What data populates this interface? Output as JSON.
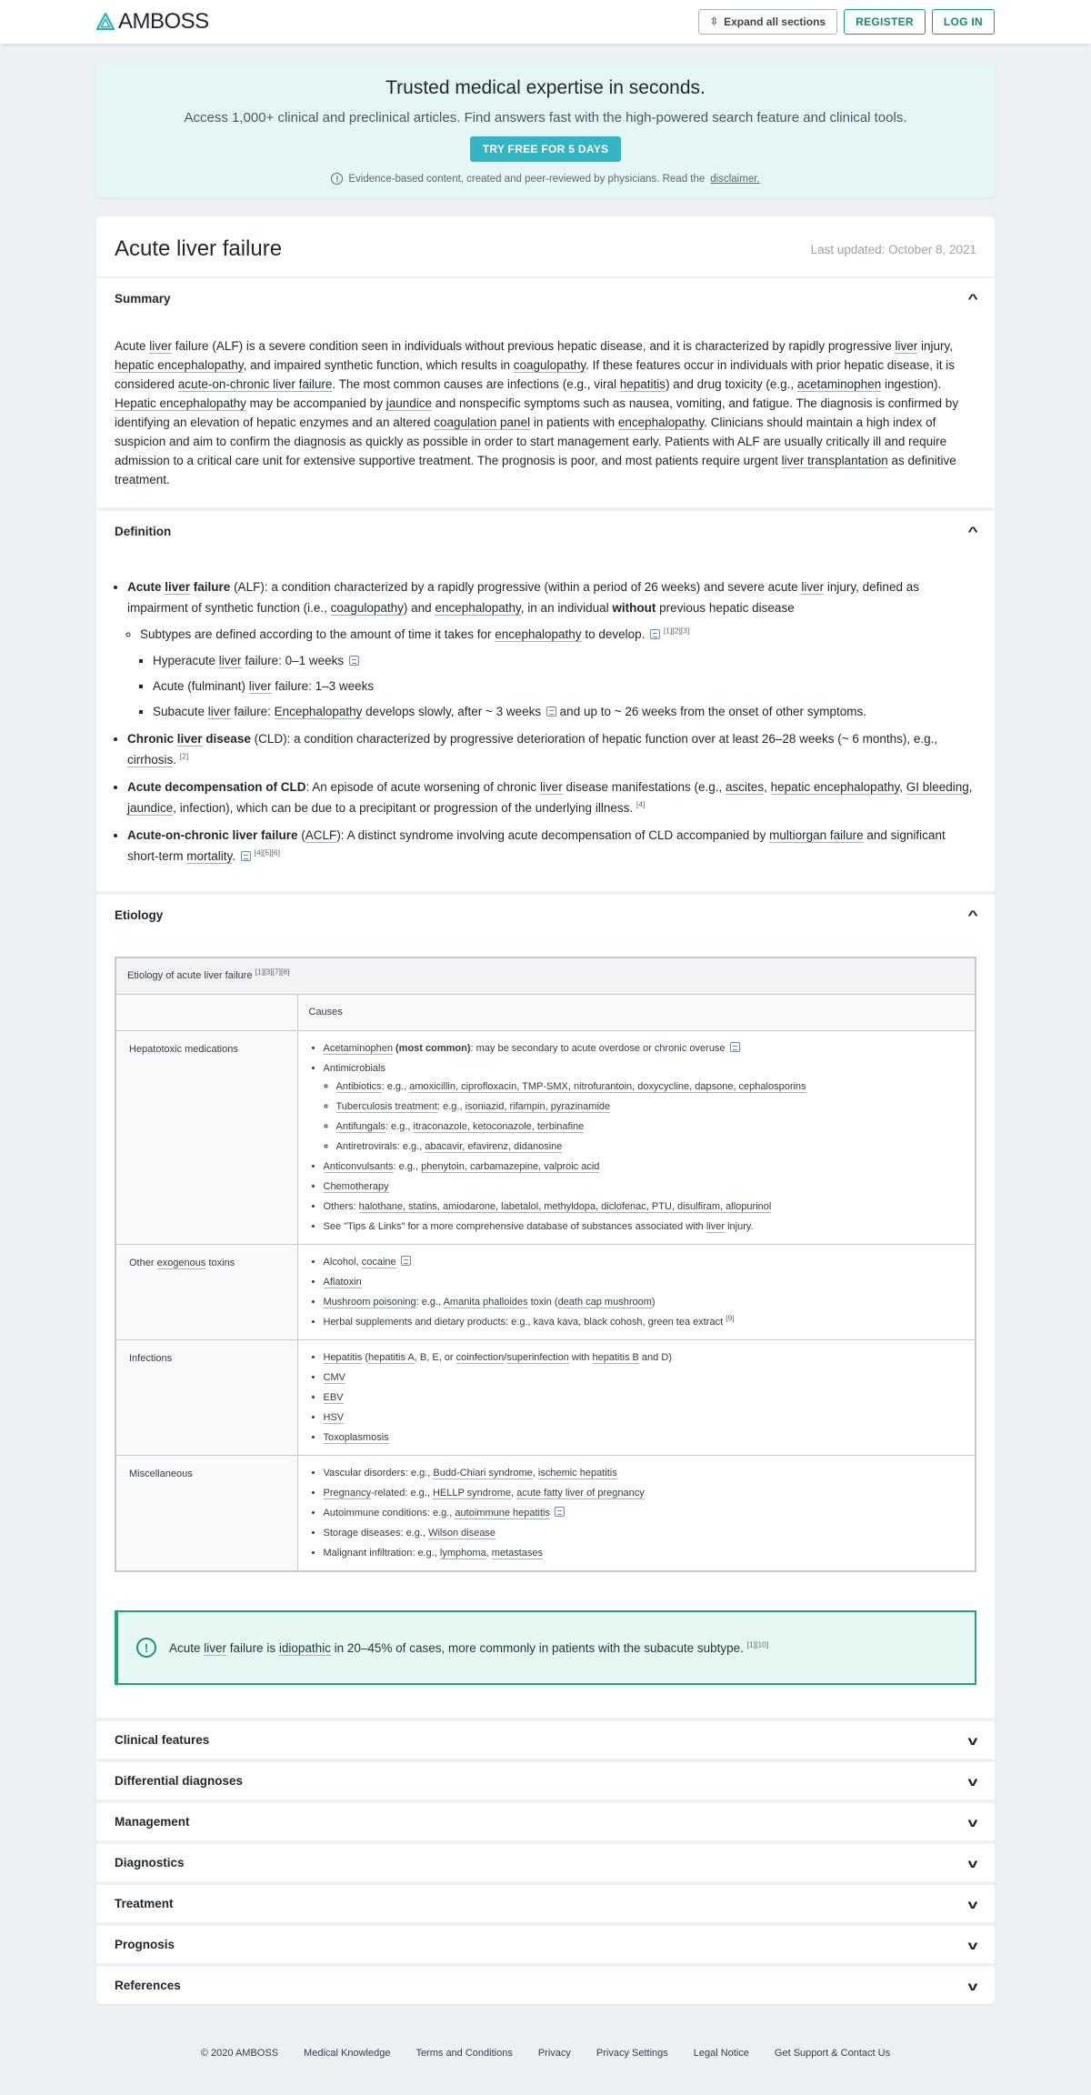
{
  "header": {
    "brand": "AMBOSS",
    "expand_label": "Expand all sections",
    "register_label": "REGISTER",
    "login_label": "LOG IN",
    "accent": "#11a37a"
  },
  "promo": {
    "title": "Trusted medical expertise in seconds.",
    "subtitle": "Access 1,000+ clinical and preclinical articles. Find answers fast with the high-powered search feature and clinical tools.",
    "cta": "TRY FREE FOR 5 DAYS",
    "note": "Evidence-based content, created and peer-reviewed by physicians. Read the",
    "note_link": "disclaimer."
  },
  "article": {
    "title": "Acute liver failure",
    "updated": "Last updated: October 8, 2021"
  },
  "sections": {
    "summary": {
      "title": "Summary"
    },
    "definition": {
      "title": "Definition"
    },
    "etiology": {
      "title": "Etiology"
    }
  },
  "collapsed_sections": [
    "Clinical features",
    "Differential diagnoses",
    "Management",
    "Diagnostics",
    "Treatment",
    "Prognosis",
    "References"
  ],
  "summary": {
    "t1": "Acute ",
    "l1": "liver",
    "t2": " failure (ALF) is a severe condition seen in individuals without previous hepatic disease, and it is characterized by rapidly progressive ",
    "l2": "liver",
    "t3": " injury, ",
    "l3": "hepatic encephalopathy",
    "t4": ", and impaired synthetic function, which results in ",
    "l4": "coagulopathy",
    "t5": ". If these features occur in individuals with prior hepatic disease, it is considered ",
    "l5": "acute-on-chronic liver failure",
    "t6": ". The most common causes are infections (e.g., viral ",
    "l6": "hepatitis",
    "t7": ") and drug toxicity (e.g., ",
    "l7": "acetaminophen",
    "t8": " ingestion). ",
    "l8": "Hepatic encephalopathy",
    "t9": " may be accompanied by ",
    "l9": "jaundice",
    "t10": " and nonspecific symptoms such as nausea, vomiting, and fatigue. The diagnosis is confirmed by identifying an elevation of hepatic enzymes and an altered ",
    "l10": "coagulation panel",
    "t11": " in patients with ",
    "l11": "encephalopathy",
    "t12": ". Clinicians should maintain a high index of suspicion and aim to confirm the diagnosis as quickly as possible in order to start management early. Patients with ALF are usually critically ill and require admission to a critical care unit for extensive supportive treatment. The prognosis is poor, and most patients require urgent ",
    "l12": "liver transplantation",
    "t13": " as definitive treatment."
  },
  "definition": {
    "alf": {
      "b1": "Acute ",
      "l1": "liver",
      "b2": " failure",
      "t1": " (ALF): a condition characterized by a rapidly progressive (within a period of 26 weeks) and severe acute ",
      "l2": "liver",
      "t2": " injury, defined as impairment of synthetic function (i.e., ",
      "l3": "coagulopathy",
      "t3": ") and ",
      "l4": "encephalopathy",
      "t4": ", in an individual ",
      "b3": "without",
      "t5": " previous hepatic disease"
    },
    "subtypes": {
      "t1": "Subtypes are defined according to the amount of time it takes for ",
      "l1": "encephalopathy",
      "t2": " to develop.",
      "refs": "[1][2][3]"
    },
    "hyper": {
      "t1": "Hyperacute ",
      "l1": "liver",
      "t2": " failure: 0–1 weeks"
    },
    "acute": {
      "t1": "Acute (fulminant) ",
      "l1": "liver",
      "t2": " failure: 1–3 weeks"
    },
    "subacute": {
      "t1": "Subacute ",
      "l1": "liver",
      "t2": " failure: ",
      "l2": "Encephalopathy",
      "t3": " develops slowly, after ~ 3 weeks",
      "t4": " and up to ~ 26 weeks from the onset of other symptoms."
    },
    "cld": {
      "b1": "Chronic ",
      "l1": "liver",
      "b2": " disease",
      "t1": " (CLD): a condition characterized by progressive deterioration of hepatic function over at least 26–28 weeks (~ 6 months), e.g., ",
      "l2": "cirrhosis",
      "t2": ".",
      "refs": "[2]"
    },
    "decomp": {
      "b1": "Acute decompensation of CLD",
      "t1": ": An episode of acute worsening of chronic ",
      "l1": "liver",
      "t2": " disease manifestations (e.g., ",
      "l2": "ascites",
      "t3": ", ",
      "l3": "hepatic encephalopathy",
      "t4": ", ",
      "l4": "GI bleeding",
      "t5": ", ",
      "l5": "jaundice",
      "t6": ", infection), which can be due to a precipitant or progression of the underlying illness.",
      "refs": "[4]"
    },
    "aclf": {
      "b1": "Acute-on-chronic liver failure",
      "t1": " (",
      "l1": "ACLF",
      "t2": "): A distinct syndrome involving acute decompensation of CLD accompanied by ",
      "l2": "multiorgan failure",
      "t3": " and significant short-term ",
      "l3": "mortality",
      "t4": ".",
      "refs": "[4][5][6]"
    }
  },
  "etiology_table": {
    "caption": "Etiology of acute liver failure",
    "caption_refs": "[1][3][7][8]",
    "col_header": "Causes",
    "rows": {
      "meds": {
        "label": "Hepatotoxic medications",
        "acet": {
          "l": "Acetaminophen",
          "b": " (most common)",
          "t": ": may be secondary to acute overdose or chronic overuse"
        },
        "antimicrobials": "Antimicrobials",
        "antibiotics": {
          "l": "Antibiotics",
          "t": ": e.g., ",
          "items": "amoxicillin, ciprofloxacin, TMP-SMX, nitrofurantoin, doxycycline, dapsone, cephalosporins"
        },
        "tb": {
          "l": "Tuberculosis treatment",
          "t": ": e.g., ",
          "items": "isoniazid, rifampin, pyrazinamide"
        },
        "antifungals": {
          "l": "Antifungals",
          "t": ": e.g., ",
          "items": "itraconazole, ketoconazole, terbinafine"
        },
        "antiretro": {
          "t": "Antiretrovirals: e.g., ",
          "items": "abacavir, efavirenz, didanosine"
        },
        "anticonv": {
          "l": "Anticonvulsants",
          "t": ": e.g., ",
          "items": "phenytoin, carbamazepine, valproic acid"
        },
        "chemo": "Chemotherapy",
        "others": {
          "t": "Others: ",
          "items": "halothane, statins, amiodarone, labetalol, methyldopa, diclofenac, PTU, disulfiram, allopurinol"
        },
        "tips": {
          "t1": "See \"Tips & Links\" for a more comprehensive database of substances associated with ",
          "l": "liver",
          "t2": " injury."
        }
      },
      "toxins": {
        "label_t": "Other ",
        "label_l": "exogenous",
        "label_t2": " toxins",
        "alcohol": {
          "t": "Alcohol, ",
          "l": "cocaine"
        },
        "aflatoxin": "Aflatoxin",
        "mushroom": {
          "l1": "Mushroom poisoning",
          "t1": ": e.g., ",
          "l2": "Amanita phalloides",
          "t2": " toxin (",
          "l3": "death cap mushroom",
          "t3": ")"
        },
        "herbal": {
          "t": "Herbal supplements and dietary products: e.g., kava kava, black cohosh, green tea extract",
          "refs": "[9]"
        }
      },
      "infections": {
        "label": "Infections",
        "hep": {
          "l1": "Hepatitis",
          "t1": " (",
          "l2": "hepatitis A",
          "t2": ", B, E, or ",
          "l3": "coinfection",
          "t3": "/",
          "l4": "superinfection",
          "t4": " with ",
          "l5": "hepatitis B",
          "t5": " and D)"
        },
        "cmv": "CMV",
        "ebv": "EBV",
        "hsv": "HSV",
        "toxo": "Toxoplasmosis"
      },
      "misc": {
        "label": "Miscellaneous",
        "vasc": {
          "t": "Vascular disorders: e.g., ",
          "l1": "Budd-Chiari syndrome",
          "l2": "ischemic hepatitis"
        },
        "preg": {
          "l0": "Pregnancy",
          "t": "-related: e.g., ",
          "l1": "HELLP syndrome",
          "l2": "acute fatty liver of pregnancy"
        },
        "auto": {
          "t": "Autoimmune conditions: e.g., ",
          "l1": "autoimmune hepatitis"
        },
        "storage": {
          "t": "Storage diseases: e.g., ",
          "l1": "Wilson disease"
        },
        "malig": {
          "t": "Malignant infiltration: e.g., ",
          "l1": "lymphoma",
          "l2": "metastases"
        }
      }
    }
  },
  "callout": {
    "t1": "Acute ",
    "l1": "liver",
    "t2": " failure is ",
    "l2": "idiopathic",
    "t3": " in 20–45% of cases, more commonly in patients with the subacute subtype.",
    "refs": "[1][10]"
  },
  "footer": [
    "© 2020 AMBOSS",
    "Medical Knowledge",
    "Terms and Conditions",
    "Privacy",
    "Privacy Settings",
    "Legal Notice",
    "Get Support & Contact Us"
  ]
}
